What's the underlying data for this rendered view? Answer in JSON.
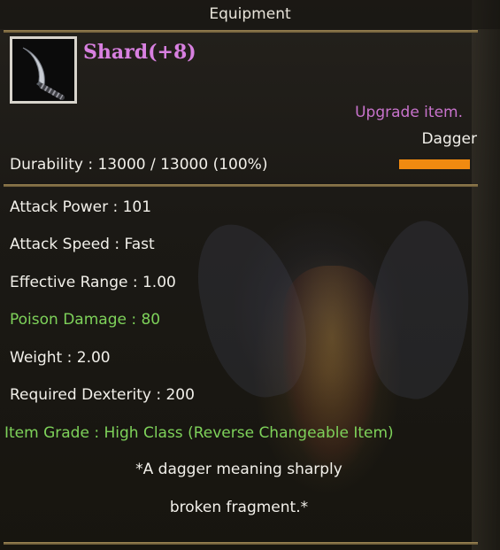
{
  "window": {
    "title": "Equipment"
  },
  "item": {
    "icon": "dagger-icon",
    "name": "Shard(+8)",
    "upgrade_text": "Upgrade item.",
    "type": "Dagger",
    "durability": "Durability : 13000 / 13000 (100%)",
    "durability_fraction": 1.0
  },
  "stats": {
    "attack_power": "Attack Power : 101",
    "attack_speed": "Attack Speed : Fast",
    "effective_range": "Effective Range : 1.00",
    "poison_damage": "Poison Damage : 80",
    "weight": "Weight : 2.00",
    "required_dexterity": "Required Dexterity : 200"
  },
  "grade": "Item Grade : High Class (Reverse Changeable Item)",
  "description": {
    "line1": "*A dagger meaning sharply",
    "line2": "broken fragment.*"
  },
  "colors": {
    "name": "#d880e0",
    "upgrade": "#c873cc",
    "special_stat": "#7ed25a",
    "durability_bar": "#f08a10"
  }
}
